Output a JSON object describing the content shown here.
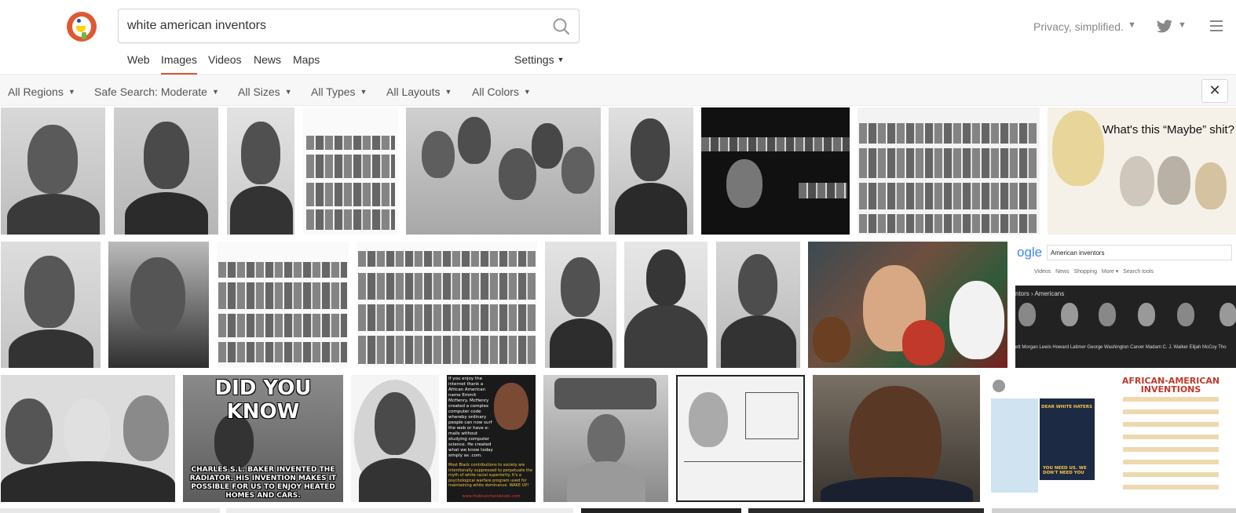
{
  "search": {
    "query": "white american inventors"
  },
  "header": {
    "tagline": "Privacy, simplified."
  },
  "tabs": [
    {
      "label": "Web"
    },
    {
      "label": "Images"
    },
    {
      "label": "Videos"
    },
    {
      "label": "News"
    },
    {
      "label": "Maps"
    }
  ],
  "settings_label": "Settings",
  "filters": [
    {
      "label": "All Regions"
    },
    {
      "label": "Safe Search: Moderate"
    },
    {
      "label": "All Sizes"
    },
    {
      "label": "All Types"
    },
    {
      "label": "All Layouts"
    },
    {
      "label": "All Colors"
    }
  ],
  "close_label": "✕",
  "colors": {
    "brand": "#de5833",
    "text": "#333333",
    "muted": "#888888",
    "filter_bg": "#f7f7f7"
  },
  "icons": [
    "duckduckgo-logo-icon",
    "search-icon",
    "twitter-icon",
    "chevron-down-icon",
    "menu-icon",
    "close-icon"
  ],
  "results": {
    "meme_caption": "What's this “Maybe” shit?",
    "google_query": "American inventors",
    "google_tabs": "Videos   News   Shopping   More ▾   Search tools",
    "google_breadcrumb": "ntors › Americans",
    "google_names": "ett Morgan   Lewis Howard Latimer   George Washington Carver   Madam C. J. Walker   Elijah McCoy   Tho",
    "did_you_know_title": "DID YOU KNOW",
    "did_you_know_caption": "CHARLES S.L. BAKER INVENTED THE RADIATOR. HIS INVENTION MAKES IT POSSIBLE FOR US TO ENJOY HEATED HOMES AND CARS.",
    "mcHenry_text": "If you enjoy the internet thank a African American name Emmit McHenry. McHenry created a complex computer code whereby ordinary people can now surf the web or have e-mails without studying computer science. He created what we know today simply as .com.",
    "mcHenry_bottom": "Most Black contributions to society are intentionally suppressed to perpetuate the myth of white racial superiority. It's a psychological warfare program used for maintaining white dominance. WAKE UP!",
    "mcHenry_url": "www.thebluecheckbooks.com",
    "tweet_banner": "DEAR WHITE HATERS",
    "tweet_line": "YOU NEED US. WE DON'T NEED YOU",
    "poster_title": "AFRICAN-AMERICAN INVENTIONS"
  }
}
